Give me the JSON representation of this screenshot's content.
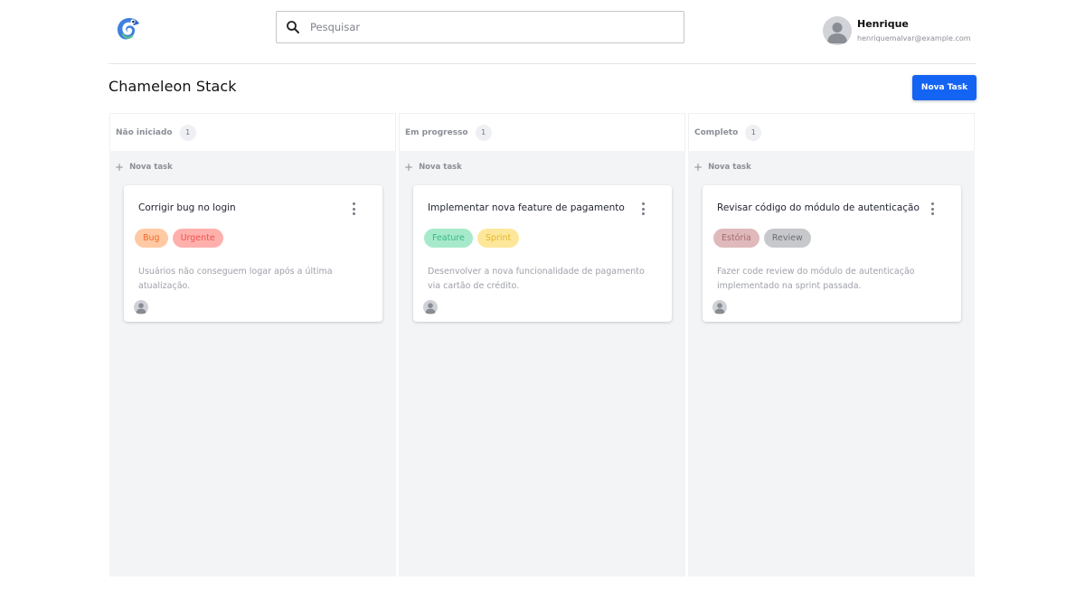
{
  "header": {
    "logo_icon": "chameleon-logo-icon",
    "search": {
      "placeholder": "Pesquisar",
      "value": ""
    },
    "user": {
      "name": "Henrique",
      "email": "henriquemalvar@example.com"
    }
  },
  "page": {
    "title": "Chameleon Stack",
    "new_task_label": "Nova Task"
  },
  "colors": {
    "accent": "#1464f4",
    "background": "#f3f4f6"
  },
  "columns": [
    {
      "title": "Não iniciado",
      "count": "1",
      "add_label": "Nova task",
      "cards": [
        {
          "title": "Corrigir bug no login",
          "tags": [
            {
              "label": "Bug",
              "bg": "#ffc9a3",
              "color": "#f26b2e"
            },
            {
              "label": "Urgente",
              "bg": "#ffb0ad",
              "color": "#f0534c"
            }
          ],
          "description": "Usuários não conseguem logar após a última atualização."
        }
      ]
    },
    {
      "title": "Em progresso",
      "count": "1",
      "add_label": "Nova task",
      "cards": [
        {
          "title": "Implementar nova feature de pagamento",
          "tags": [
            {
              "label": "Feature",
              "bg": "#a6eacb",
              "color": "#3bb78a"
            },
            {
              "label": "Sprint",
              "bg": "#fde79a",
              "color": "#e6b72f"
            }
          ],
          "description": "Desenvolver a nova funcionalidade de pagamento via cartão de crédito."
        }
      ]
    },
    {
      "title": "Completo",
      "count": "1",
      "add_label": "Nova task",
      "cards": [
        {
          "title": "Revisar código do módulo de autenticação",
          "tags": [
            {
              "label": "Estória",
              "bg": "#dfb9bb",
              "color": "#a86b70"
            },
            {
              "label": "Review",
              "bg": "#c7c8cc",
              "color": "#6c6e75"
            }
          ],
          "description": "Fazer code review do módulo de autenticação implementado na sprint passada."
        }
      ]
    }
  ]
}
